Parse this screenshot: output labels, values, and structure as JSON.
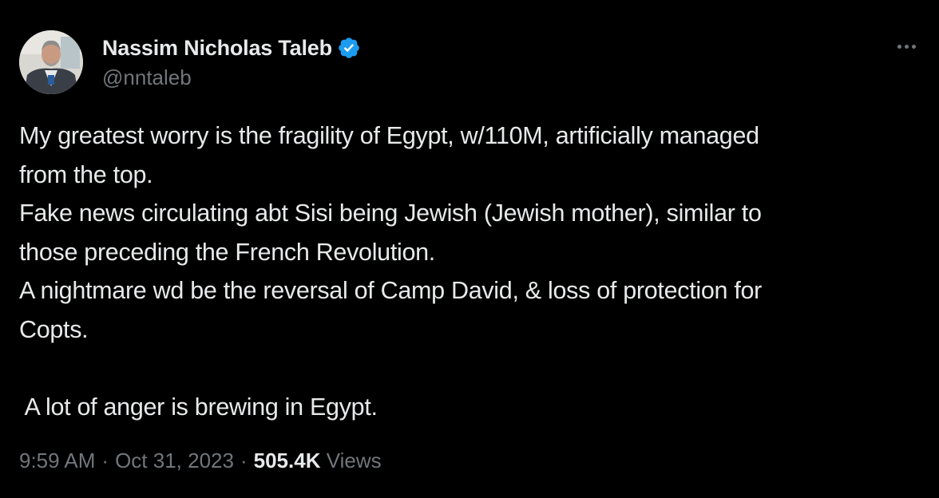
{
  "author": {
    "display_name": "Nassim Nicholas Taleb",
    "handle": "@nntaleb",
    "verified": true,
    "verified_color": "#1d9bf0"
  },
  "tweet": {
    "lines": [
      "My greatest worry is the fragility of Egypt, w/110M, artificially managed",
      "from the top.",
      "Fake news circulating abt Sisi being Jewish (Jewish mother), similar to",
      "those preceding the French Revolution.",
      "A nightmare wd be the reversal of Camp David, & loss of protection for",
      "Copts.",
      "",
      " A lot of anger is brewing in Egypt."
    ]
  },
  "meta": {
    "time": "9:59 AM",
    "separator": "·",
    "date": "Oct 31, 2023",
    "views_count": "505.4K",
    "views_label": "Views"
  },
  "icons": {
    "more": "more-horizontal-icon",
    "verified": "verified-badge-icon"
  },
  "colors": {
    "background": "#000000",
    "primary_text": "#e7e9ea",
    "secondary_text": "#71767b"
  }
}
